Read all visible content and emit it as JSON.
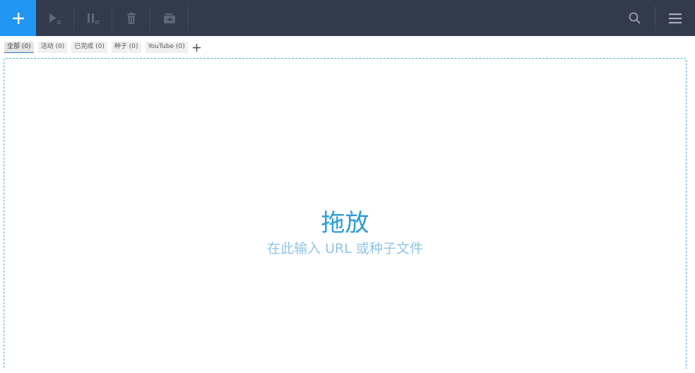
{
  "toolbar": {
    "icons": [
      "plus-icon",
      "start-all-icon",
      "pause-all-icon",
      "trash-icon",
      "folder-icon",
      "search-icon",
      "menu-icon"
    ],
    "accent": "#2196f3",
    "background": "#333a4b"
  },
  "tabs": [
    {
      "label": "全部 (0)",
      "active": true
    },
    {
      "label": "活动 (0)",
      "active": false
    },
    {
      "label": "已完成 (0)",
      "active": false
    },
    {
      "label": "种子 (0)",
      "active": false
    },
    {
      "label": "YouTube (0)",
      "active": false
    }
  ],
  "dropzone": {
    "title": "拖放",
    "subtitle": "在此输入 URL 或种子文件"
  }
}
